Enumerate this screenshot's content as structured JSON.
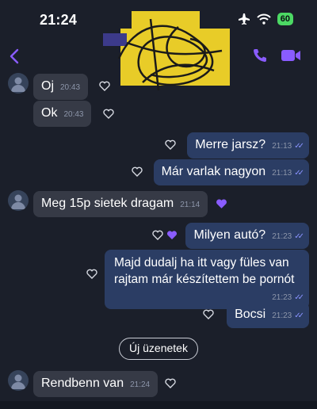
{
  "status_bar": {
    "time": "21:24",
    "battery": "60"
  },
  "header": {
    "back_icon": "chevron-left-icon",
    "call_icon": "phone-icon",
    "video_icon": "video-camera-icon"
  },
  "colors": {
    "background": "#1b1f2a",
    "incoming_bubble": "#363a46",
    "outgoing_bubble": "#2b3d64",
    "accent": "#8a5cff"
  },
  "messages": [
    {
      "text": "Oj",
      "time": "20:43"
    },
    {
      "text": "Ok",
      "time": "20:43"
    },
    {
      "text": "Merre jarsz?",
      "time": "21:13"
    },
    {
      "text": "Már varlak nagyon",
      "time": "21:13"
    },
    {
      "text": "Meg 15p sietek dragam",
      "time": "21:14"
    },
    {
      "text": "Milyen autó?",
      "time": "21:23"
    },
    {
      "text": "Majd dudalj ha itt vagy füles van rajtam már készítettem be pornót",
      "time": "21:23"
    },
    {
      "text": "Bocsi",
      "time": "21:23"
    },
    {
      "text": "Rendbenn van",
      "time": "21:24"
    }
  ],
  "new_messages_label": "Új üzenetek"
}
